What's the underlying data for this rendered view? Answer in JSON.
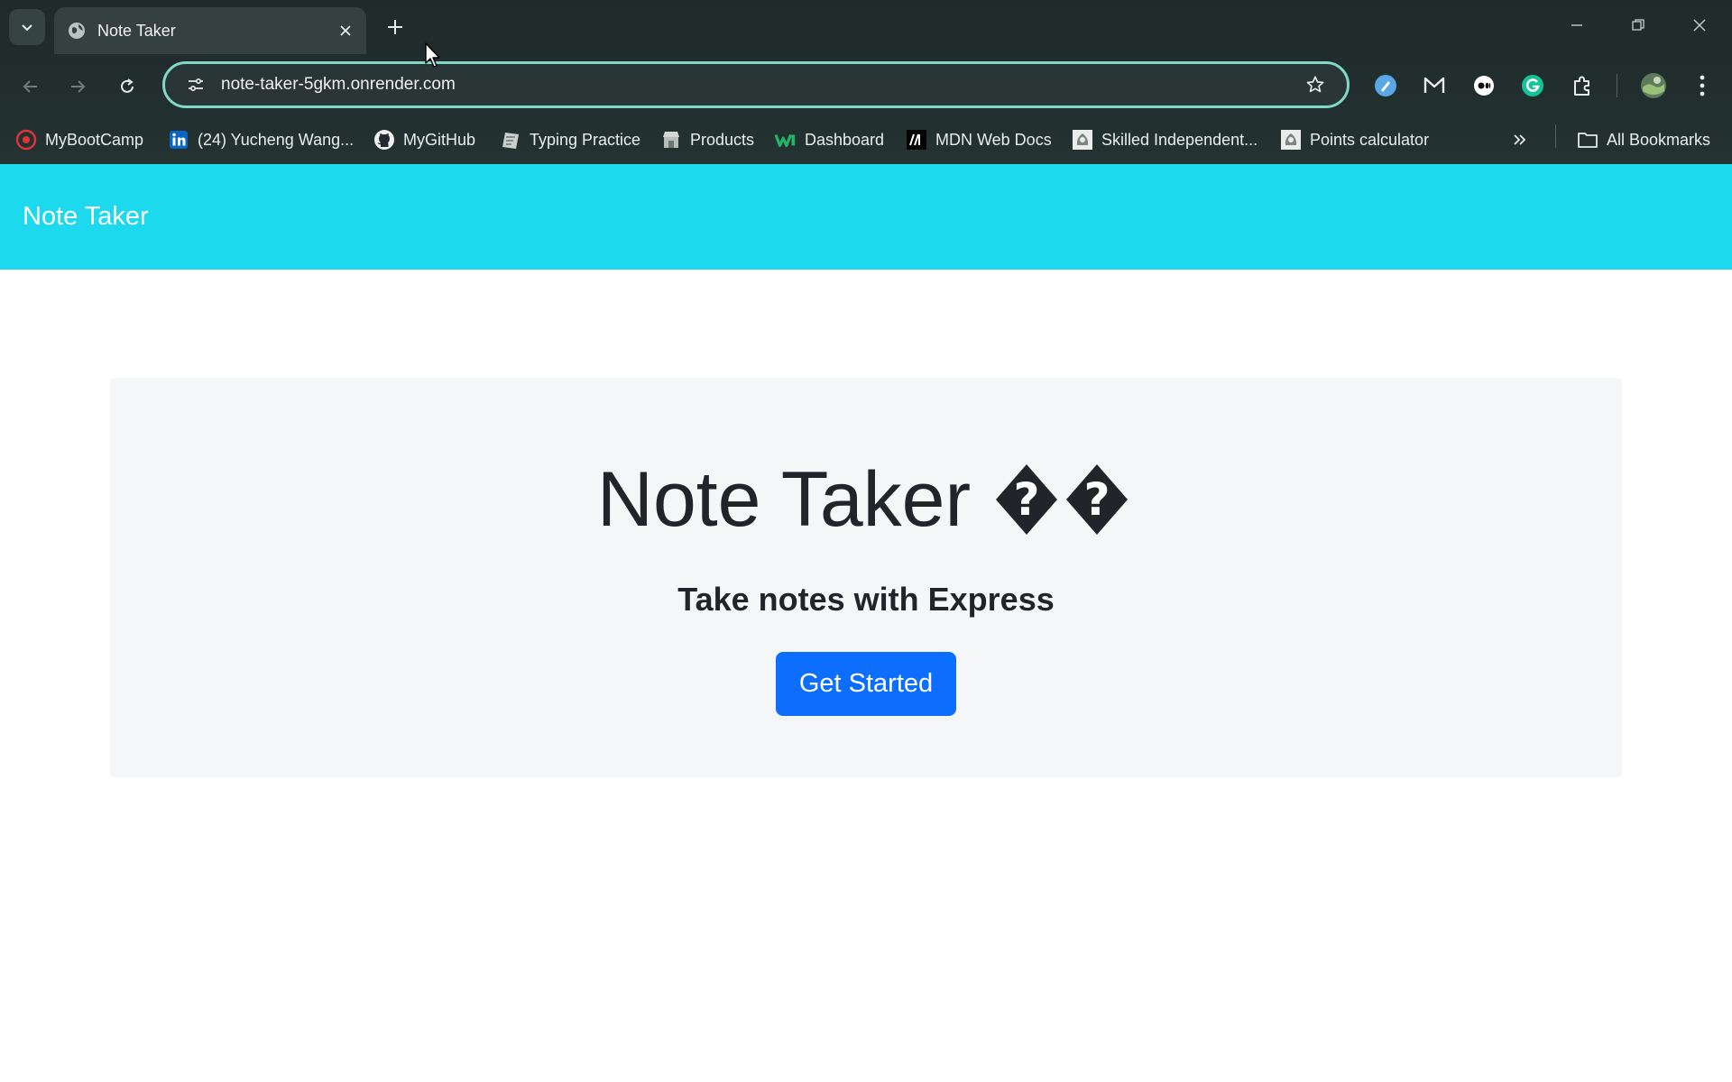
{
  "browser": {
    "tab": {
      "title": "Note Taker",
      "favicon": "globe-icon"
    },
    "address_bar": {
      "url": "note-taker-5gkm.onrender.com"
    },
    "bookmarks": [
      {
        "label": "MyBootCamp",
        "icon": "bootcamp-icon"
      },
      {
        "label": "(24) Yucheng Wang...",
        "icon": "linkedin-icon"
      },
      {
        "label": "MyGitHub",
        "icon": "github-icon"
      },
      {
        "label": "Typing Practice",
        "icon": "typing-icon"
      },
      {
        "label": "Products",
        "icon": "store-icon"
      },
      {
        "label": "Dashboard",
        "icon": "w-icon"
      },
      {
        "label": "MDN Web Docs",
        "icon": "mdn-icon"
      },
      {
        "label": "Skilled Independent...",
        "icon": "gov-crest-icon"
      },
      {
        "label": "Points calculator",
        "icon": "gov-crest-icon"
      }
    ],
    "all_bookmarks_label": "All Bookmarks",
    "accent_color": "#7fd9c4"
  },
  "page": {
    "navbar": {
      "brand": "Note Taker",
      "color": "#1cd9ee"
    },
    "hero": {
      "title": "Note Taker",
      "title_glyphs": "��",
      "subtitle": "Take notes with Express",
      "cta_label": "Get Started",
      "cta_color": "#0d6efd"
    }
  }
}
